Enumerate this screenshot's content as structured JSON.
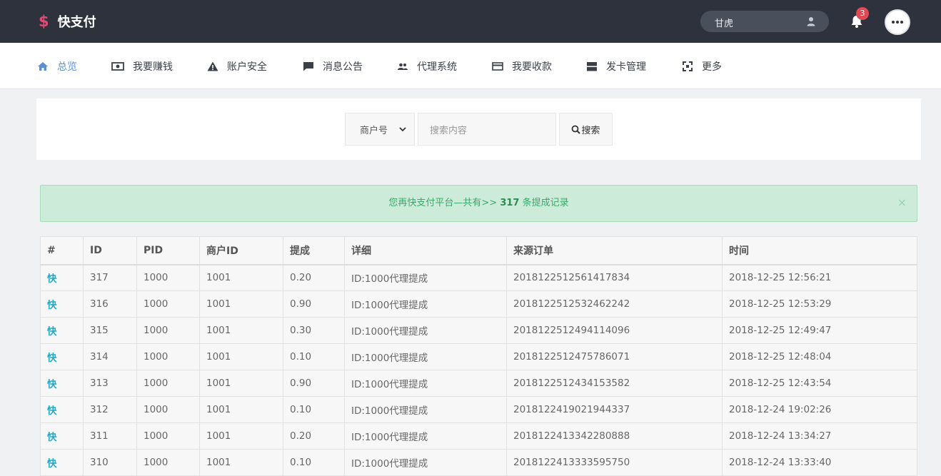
{
  "brand": {
    "icon": "dollar-icon",
    "name": "快支付",
    "accent": "#e04a74"
  },
  "header": {
    "username": "甘虎",
    "notification_count": "3"
  },
  "nav": [
    {
      "label": "总览",
      "icon": "home-icon",
      "active": true
    },
    {
      "label": "我要赚钱",
      "icon": "money-icon"
    },
    {
      "label": "账户安全",
      "icon": "warning-icon"
    },
    {
      "label": "消息公告",
      "icon": "message-icon"
    },
    {
      "label": "代理系统",
      "icon": "users-icon"
    },
    {
      "label": "我要收款",
      "icon": "credit-card-icon"
    },
    {
      "label": "发卡管理",
      "icon": "card-stack-icon"
    },
    {
      "label": "更多",
      "icon": "expand-icon"
    }
  ],
  "search": {
    "select_value": "商户号",
    "placeholder": "搜索内容",
    "button_label": "搜索"
  },
  "alert": {
    "prefix": "您再快支付平台—共有>> ",
    "count": "317",
    "suffix": " 条提成记录",
    "close": "×"
  },
  "table": {
    "columns": [
      "#",
      "ID",
      "PID",
      "商户ID",
      "提成",
      "详细",
      "来源订单",
      "时间"
    ],
    "rows": [
      [
        "快",
        "317",
        "1000",
        "1001",
        "0.20",
        "ID:1000代理提成",
        "2018122512561417834",
        "2018-12-25 12:56:21"
      ],
      [
        "快",
        "316",
        "1000",
        "1001",
        "0.90",
        "ID:1000代理提成",
        "2018122512532462242",
        "2018-12-25 12:53:29"
      ],
      [
        "快",
        "315",
        "1000",
        "1001",
        "0.30",
        "ID:1000代理提成",
        "2018122512494114096",
        "2018-12-25 12:49:47"
      ],
      [
        "快",
        "314",
        "1000",
        "1001",
        "0.10",
        "ID:1000代理提成",
        "2018122512475786071",
        "2018-12-25 12:48:04"
      ],
      [
        "快",
        "313",
        "1000",
        "1001",
        "0.90",
        "ID:1000代理提成",
        "2018122512434153582",
        "2018-12-25 12:43:54"
      ],
      [
        "快",
        "312",
        "1000",
        "1001",
        "0.10",
        "ID:1000代理提成",
        "2018122419021944337",
        "2018-12-24 19:02:26"
      ],
      [
        "快",
        "311",
        "1000",
        "1001",
        "0.20",
        "ID:1000代理提成",
        "2018122413342280888",
        "2018-12-24 13:34:27"
      ],
      [
        "快",
        "310",
        "1000",
        "1001",
        "0.10",
        "ID:1000代理提成",
        "2018122413333595750",
        "2018-12-24 13:33:40"
      ]
    ]
  }
}
